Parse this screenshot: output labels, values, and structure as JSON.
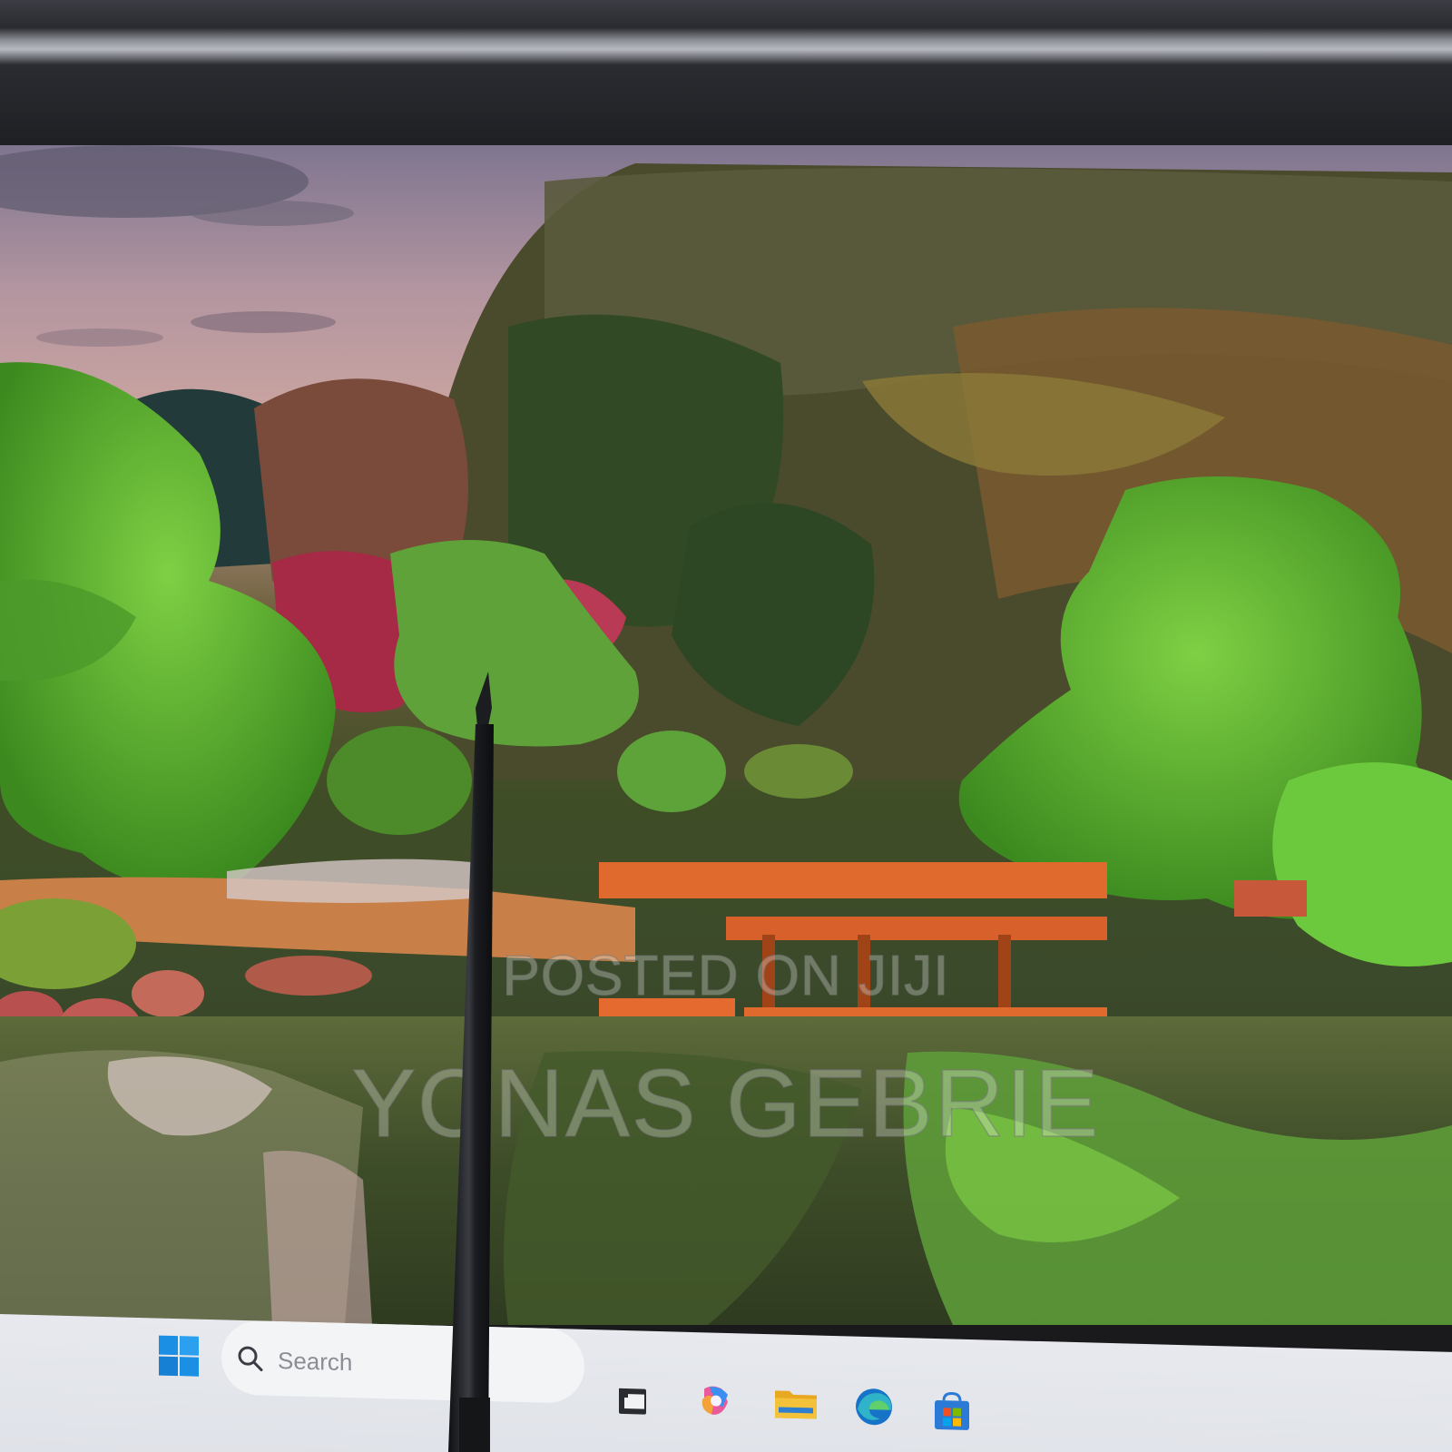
{
  "taskbar": {
    "search_placeholder": "Search",
    "pinned_icons": [
      "task-view-icon",
      "copilot-icon",
      "file-explorer-icon",
      "edge-icon",
      "microsoft-store-icon"
    ]
  },
  "watermark": {
    "line1": "POSTED ON JIJI",
    "line2": "YONAS GEBRIE"
  },
  "colors": {
    "windows_blue": "#1a8fe3",
    "folder_yellow": "#f3c13a",
    "edge_teal": "#2fb3c8",
    "copilot_pink": "#e85a9a",
    "taskbar_bg": "#e7e9ee"
  }
}
